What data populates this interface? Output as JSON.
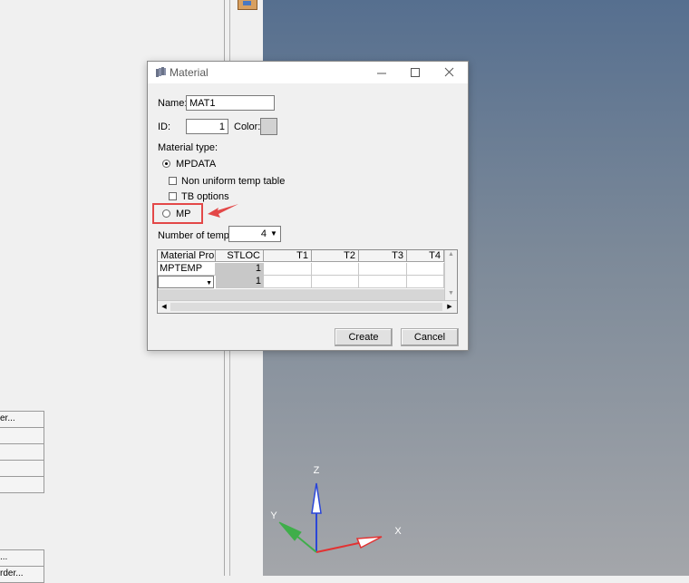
{
  "dialog": {
    "title": "Material",
    "name_label": "Name:",
    "name_value": "MAT1",
    "id_label": "ID:",
    "id_value": "1",
    "color_label": "Color:",
    "material_type_label": "Material type:",
    "options": {
      "mpdata": "MPDATA",
      "non_uniform": "Non uniform temp table",
      "tb_options": "TB options",
      "mp": "MP"
    },
    "num_temp_label": "Number of temp:",
    "num_temp_value": "4",
    "grid": {
      "headers": [
        "Material Prop",
        "STLOC",
        "T1",
        "T2",
        "T3",
        "T4"
      ],
      "rows": [
        {
          "prop": "MPTEMP",
          "stloc": "1"
        },
        {
          "prop": "",
          "stloc": "1"
        }
      ]
    },
    "create_label": "Create",
    "cancel_label": "Cancel"
  },
  "left_panel": {
    "items": [
      "er...",
      "",
      "",
      "",
      "",
      "",
      "...",
      "rder..."
    ]
  },
  "viewport": {
    "axes": {
      "z": "Z",
      "y": "Y",
      "x": "X"
    },
    "colors": {
      "z": "#2a46d8",
      "y": "#3fae4a",
      "x": "#e23232",
      "annotation": "#e34848"
    }
  }
}
